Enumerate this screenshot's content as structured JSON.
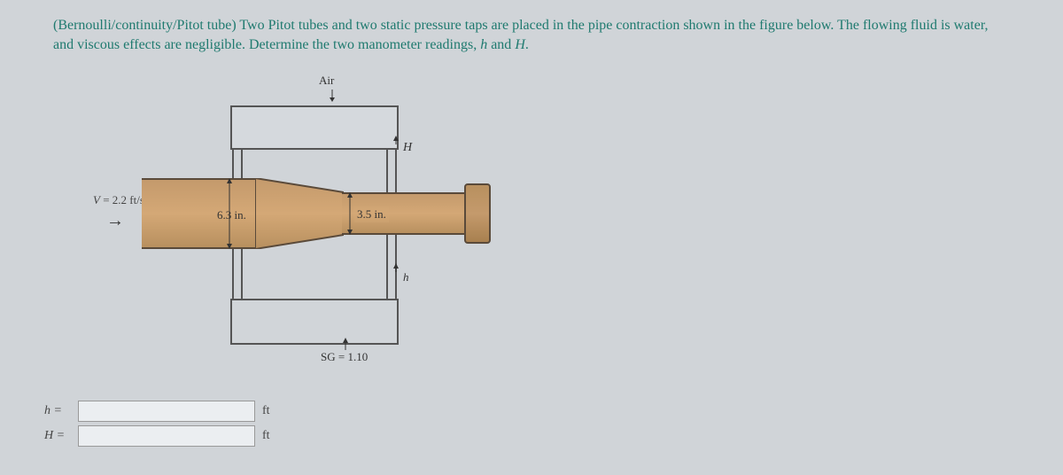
{
  "problem": {
    "topic_tag": "(Bernoulli/continuity/Pitot tube)",
    "text_part1": " Two Pitot tubes and two static pressure taps are placed in the pipe contraction shown in the figure below. The flowing fluid is water, and viscous effects are negligible. Determine the two manometer readings, ",
    "h_italic": "h",
    "text_and": " and ",
    "H_italic": "H",
    "text_end": "."
  },
  "diagram": {
    "air_label": "Air",
    "H_label": "H",
    "h_label": "h",
    "velocity": "V = 2.2 ft/s",
    "diameter_large": "6.3 in.",
    "diameter_small": "3.5 in.",
    "sg_label": "SG = 1.10"
  },
  "answers": {
    "h_label": "h =",
    "h_value": "",
    "h_unit": "ft",
    "H_label": "H =",
    "H_value": "",
    "H_unit": "ft"
  }
}
